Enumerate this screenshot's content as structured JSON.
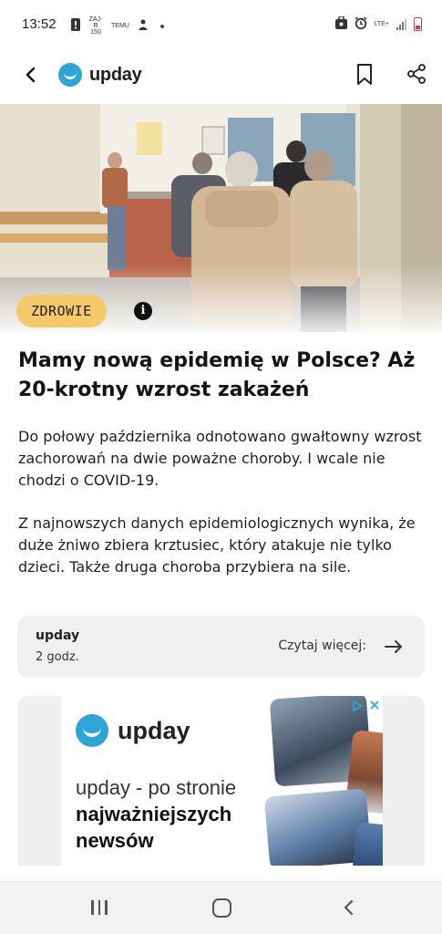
{
  "status_bar": {
    "time": "13:52",
    "icons_left": [
      "alert-icon",
      "mobile-badge-icon",
      "temu-icon",
      "sync-icon",
      "dot-icon"
    ],
    "mobile_badge_text": "ZAJ-R 150",
    "temu_text": "TEMU",
    "network_type": "LTE+",
    "icons_right": [
      "work-profile-icon",
      "alarm-icon",
      "network-icon",
      "signal-icon",
      "battery-icon"
    ]
  },
  "header": {
    "brand": "upday",
    "actions": [
      "back-icon",
      "bookmark-icon",
      "share-icon"
    ]
  },
  "article": {
    "category": "ZDROWIE",
    "headline": "Mamy nową epidemię w Polsce? Aż 20-krotny wzrost zakażeń",
    "lead": "Do połowy października odnotowano gwałtowny wzrost zachorowań na dwie poważne choroby. I wcale nie chodzi o COVID-19.",
    "body": "Z najnowszych danych epidemiologicznych wynika, że duże żniwo zbiera krztusiec, który atakuje nie tylko dzieci. Także druga choroba przybiera na sile."
  },
  "source": {
    "name": "upday",
    "time": "2 godz.",
    "read_more": "Czytaj więcej:"
  },
  "ad": {
    "brand": "upday",
    "text": "upday - po stronie",
    "bold_text": "najważniejszych newsów",
    "choices_icons": [
      "adchoices-icon",
      "close-icon"
    ]
  },
  "colors": {
    "badge": "#f4c96a",
    "brand_blue": "#2fa4d8",
    "card_bg": "#f0f0f0"
  }
}
